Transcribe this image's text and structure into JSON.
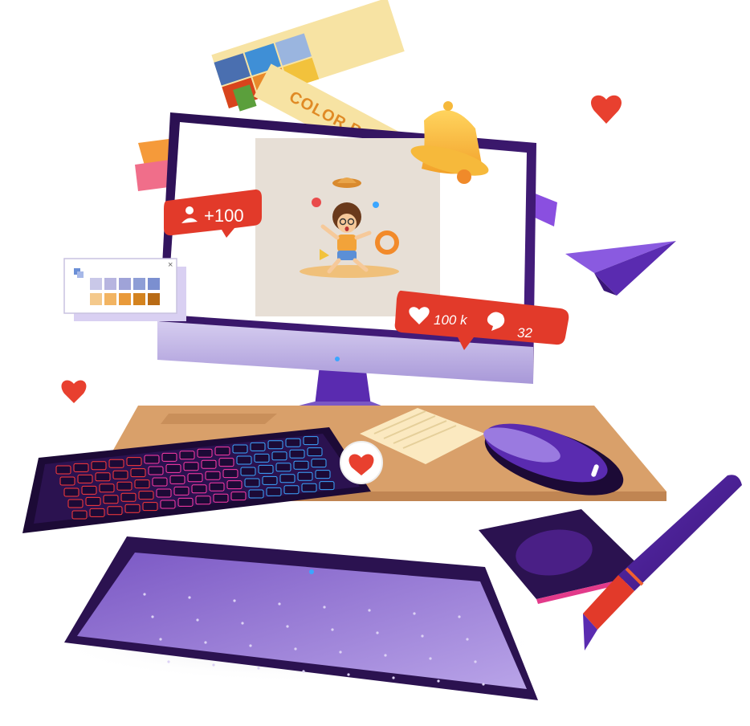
{
  "swatch_book": {
    "title": "COLOR BALANCE",
    "colors": [
      "#4a6fb0",
      "#d8441c",
      "#e9892a",
      "#c86a1e",
      "#3f8fd6",
      "#f2c23c",
      "#5b9f3c",
      "#9ab5df"
    ]
  },
  "followers_badge": {
    "label": "+100"
  },
  "engagement_badge": {
    "likes": "100 k",
    "comments": "32"
  },
  "palette_window": {
    "close": "×",
    "row1": [
      "#c9c8e8",
      "#b7b5e0",
      "#9fa3d8",
      "#8e9ed6",
      "#7b8fd0"
    ],
    "row2": [
      "#f4c98c",
      "#f2b462",
      "#e99a3a",
      "#d4831f",
      "#b86b16"
    ]
  },
  "colors": {
    "purple_dark": "#2b0f4a",
    "purple": "#5a2bb0",
    "purple_light": "#8a6fd0",
    "badge_red": "#e23a2a",
    "heart": "#e8402f",
    "desk": "#d9a06a",
    "bell": "#f6b93b"
  }
}
